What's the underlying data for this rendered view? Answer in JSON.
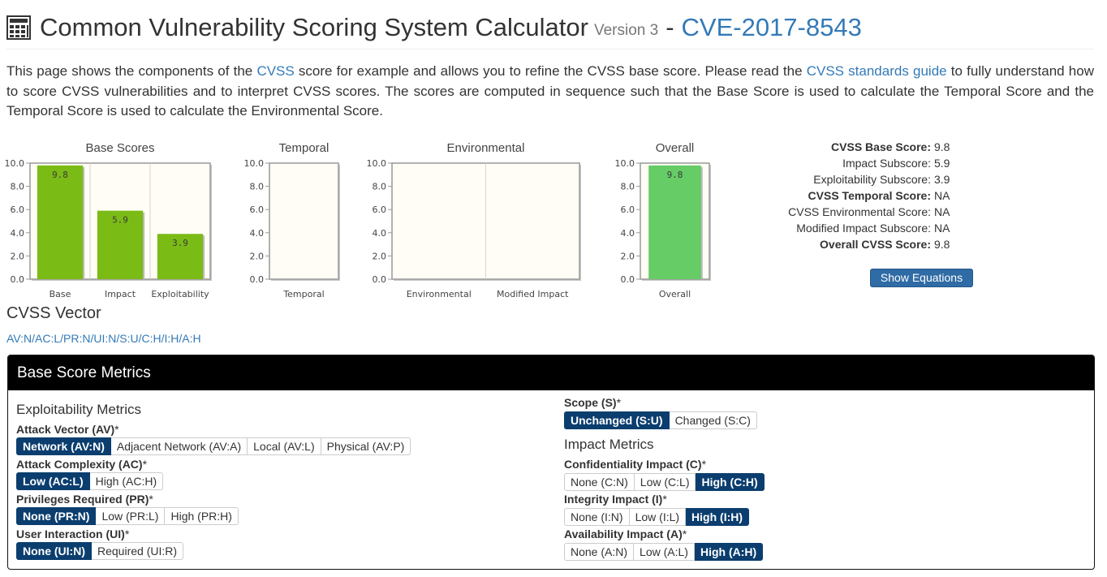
{
  "header": {
    "title": "Common Vulnerability Scoring System Calculator",
    "version": "Version 3",
    "dash": "-",
    "cve": "CVE-2017-8543"
  },
  "intro": {
    "p1": "This page shows the components of the ",
    "link1": "CVSS",
    "p2": " score for example and allows you to refine the CVSS base score. Please read the ",
    "link2": "CVSS standards guide",
    "p3": " to fully understand how to score CVSS vulnerabilities and to interpret CVSS scores. The scores are computed in sequence such that the Base Score is used to calculate the Temporal Score and the Temporal Score is used to calculate the Environmental Score."
  },
  "chart_data": [
    {
      "type": "bar",
      "title": "Base Scores",
      "categories": [
        "Base",
        "Impact",
        "Exploitability"
      ],
      "values": [
        9.8,
        5.9,
        3.9
      ],
      "labels": [
        "9.8",
        "5.9",
        "3.9"
      ],
      "ylim": [
        0,
        10
      ],
      "yticks": [
        "0.0",
        "2.0",
        "4.0",
        "6.0",
        "8.0",
        "10.0"
      ],
      "color": "#7bbb16"
    },
    {
      "type": "bar",
      "title": "Temporal",
      "categories": [
        "Temporal"
      ],
      "values": [
        null
      ],
      "labels": [
        ""
      ],
      "ylim": [
        0,
        10
      ],
      "yticks": [
        "0.0",
        "2.0",
        "4.0",
        "6.0",
        "8.0",
        "10.0"
      ],
      "color": "#7bbb16"
    },
    {
      "type": "bar",
      "title": "Environmental",
      "categories": [
        "Environmental",
        "Modified Impact"
      ],
      "values": [
        null,
        null
      ],
      "labels": [
        "",
        ""
      ],
      "ylim": [
        0,
        10
      ],
      "yticks": [
        "0.0",
        "2.0",
        "4.0",
        "6.0",
        "8.0",
        "10.0"
      ],
      "color": "#7bbb16"
    },
    {
      "type": "bar",
      "title": "Overall",
      "categories": [
        "Overall"
      ],
      "values": [
        9.8
      ],
      "labels": [
        "9.8"
      ],
      "ylim": [
        0,
        10
      ],
      "yticks": [
        "0.0",
        "2.0",
        "4.0",
        "6.0",
        "8.0",
        "10.0"
      ],
      "color": "#66cc66"
    }
  ],
  "scores": [
    {
      "label": "CVSS Base Score:",
      "value": "9.8",
      "bold": true
    },
    {
      "label": "Impact Subscore:",
      "value": "5.9",
      "bold": false
    },
    {
      "label": "Exploitability Subscore:",
      "value": "3.9",
      "bold": false
    },
    {
      "label": "CVSS Temporal Score:",
      "value": "NA",
      "bold": true
    },
    {
      "label": "CVSS Environmental Score:",
      "value": "NA",
      "bold": false
    },
    {
      "label": "Modified Impact Subscore:",
      "value": "NA",
      "bold": false
    },
    {
      "label": "Overall CVSS Score:",
      "value": "9.8",
      "bold": true
    }
  ],
  "show_equations": "Show Equations",
  "vector": {
    "heading": "CVSS Vector",
    "value": "AV:N/AC:L/PR:N/UI:N/S:U/C:H/I:H/A:H"
  },
  "panel": {
    "title": "Base Score Metrics",
    "exploitability_heading": "Exploitability Metrics",
    "impact_heading": "Impact Metrics",
    "star": "*",
    "metrics": {
      "av": {
        "label": "Attack Vector (AV)",
        "options": [
          "Network (AV:N)",
          "Adjacent Network (AV:A)",
          "Local (AV:L)",
          "Physical (AV:P)"
        ],
        "selected": 0
      },
      "ac": {
        "label": "Attack Complexity (AC)",
        "options": [
          "Low (AC:L)",
          "High (AC:H)"
        ],
        "selected": 0
      },
      "pr": {
        "label": "Privileges Required (PR)",
        "options": [
          "None (PR:N)",
          "Low (PR:L)",
          "High (PR:H)"
        ],
        "selected": 0
      },
      "ui": {
        "label": "User Interaction (UI)",
        "options": [
          "None (UI:N)",
          "Required (UI:R)"
        ],
        "selected": 0
      },
      "s": {
        "label": "Scope (S)",
        "options": [
          "Unchanged (S:U)",
          "Changed (S:C)"
        ],
        "selected": 0
      },
      "c": {
        "label": "Confidentiality Impact (C)",
        "options": [
          "None (C:N)",
          "Low (C:L)",
          "High (C:H)"
        ],
        "selected": 2
      },
      "i": {
        "label": "Integrity Impact (I)",
        "options": [
          "None (I:N)",
          "Low (I:L)",
          "High (I:H)"
        ],
        "selected": 2
      },
      "a": {
        "label": "Availability Impact (A)",
        "options": [
          "None (A:N)",
          "Low (A:L)",
          "High (A:H)"
        ],
        "selected": 2
      }
    }
  }
}
